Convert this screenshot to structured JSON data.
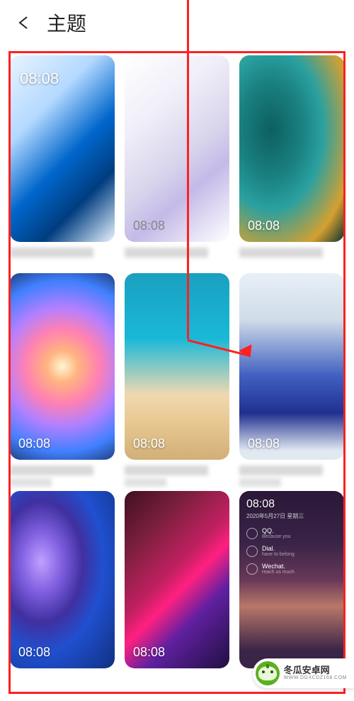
{
  "header": {
    "title": "主题"
  },
  "themes": [
    {
      "time": "08:08",
      "time_pos": "top"
    },
    {
      "time": "08:08"
    },
    {
      "time": "08:08"
    },
    {
      "time": "08:08"
    },
    {
      "time": "08:08"
    },
    {
      "time": "08:08"
    },
    {
      "time": "08:08"
    },
    {
      "time": "08:08"
    },
    {
      "time": "08:08",
      "date": "2020年5月27日 星期三",
      "rows": [
        {
          "label": "QQ.",
          "sub": "Because you"
        },
        {
          "label": "Dial.",
          "sub": "have to belong"
        },
        {
          "label": "Wechat.",
          "sub": "reach us much"
        }
      ]
    }
  ],
  "watermark": {
    "main": "冬瓜安卓网",
    "sub": "WWW.DGXCDZ168.COM"
  }
}
